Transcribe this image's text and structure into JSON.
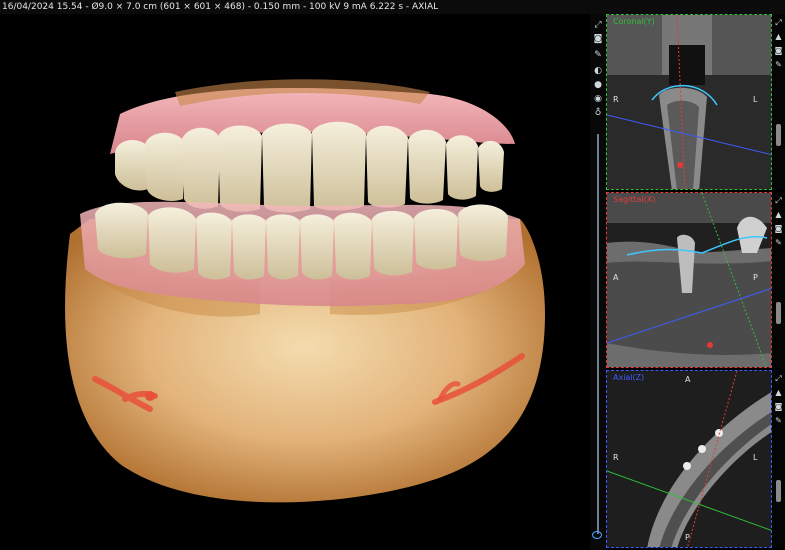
{
  "header": {
    "info": "16/04/2024 15.54 - Ø9.0 × 7.0 cm (601 × 601 × 468) - 0.150 mm - 100 kV 9 mA 6.222 s - AXIAL"
  },
  "panels": {
    "coronal": {
      "title": "Coronal(Y)",
      "left": "R",
      "right": "L"
    },
    "sagittal": {
      "title": "Sagittal(X)",
      "left": "A",
      "right": "P"
    },
    "axial": {
      "title": "Axial(Z)",
      "top": "A",
      "left": "R",
      "right": "L",
      "bottom": "P"
    }
  },
  "toolbar": {
    "icons": [
      "expand-icon",
      "camera-icon",
      "wrench-icon",
      "head-side-icon",
      "head-front-icon",
      "skull-icon",
      "tooth-icon"
    ]
  },
  "colors": {
    "coronal": "#2fbf3b",
    "sagittal": "#e43a3a",
    "axial": "#3e5bff",
    "nerve": "#e8503a",
    "gum": "#e9a2a6",
    "bone": "#d7a062"
  }
}
